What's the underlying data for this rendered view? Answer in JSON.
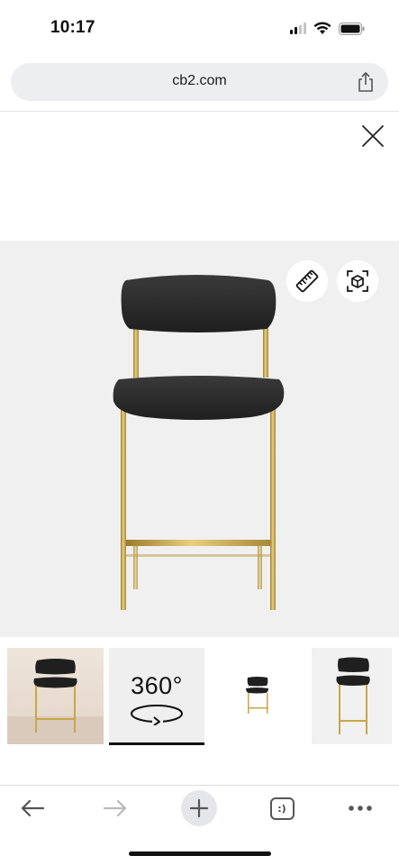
{
  "status_bar": {
    "time": "10:17",
    "icons": [
      "cellular-signal-icon",
      "wifi-icon",
      "battery-icon"
    ]
  },
  "browser": {
    "url": "cb2.com",
    "share_icon": "share-icon",
    "toolbar": {
      "back_icon": "arrow-left-icon",
      "forward_icon": "arrow-right-icon",
      "new_tab_icon": "plus-icon",
      "tabs_label": ":)",
      "more_icon": "ellipsis-icon"
    }
  },
  "viewer": {
    "close_icon": "close-icon",
    "measure_icon": "ruler-icon",
    "ar_icon": "ar-cube-icon",
    "background": "#f0f0f0",
    "product_colors": {
      "seat": "#2b2b2b",
      "frame": "#c9a64a"
    }
  },
  "thumbnails": {
    "items": [
      {
        "kind": "lifestyle-photo"
      },
      {
        "kind": "360-view",
        "label": "360°"
      },
      {
        "kind": "small-product-photo"
      },
      {
        "kind": "product-photo"
      }
    ],
    "active_index": 1
  }
}
